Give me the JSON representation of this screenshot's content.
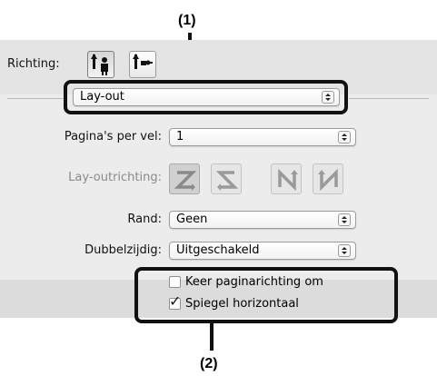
{
  "callouts": {
    "one": "(1)",
    "two": "(2)"
  },
  "orientation": {
    "label": "Richting:",
    "options": [
      {
        "icon": "portrait-orientation-icon",
        "selected": true
      },
      {
        "icon": "landscape-orientation-icon",
        "selected": false
      }
    ]
  },
  "panel_menu": {
    "value": "Lay-out"
  },
  "pages_per_sheet": {
    "label": "Pagina's per vel:",
    "value": "1"
  },
  "layout_direction": {
    "label": "Lay-outrichting:",
    "options": [
      {
        "icon": "z-layout-icon",
        "selected": true
      },
      {
        "icon": "s-layout-icon",
        "selected": false
      },
      {
        "icon": "n-reverse-layout-icon",
        "selected": false
      },
      {
        "icon": "n-layout-icon",
        "selected": false
      }
    ]
  },
  "border": {
    "label": "Rand:",
    "value": "Geen"
  },
  "duplex": {
    "label": "Dubbelzijdig:",
    "value": "Uitgeschakeld"
  },
  "reverse_orientation": {
    "label": "Keer paginarichting om",
    "checked": false
  },
  "mirror_horizontal": {
    "label": "Spiegel horizontaal",
    "checked": true
  }
}
